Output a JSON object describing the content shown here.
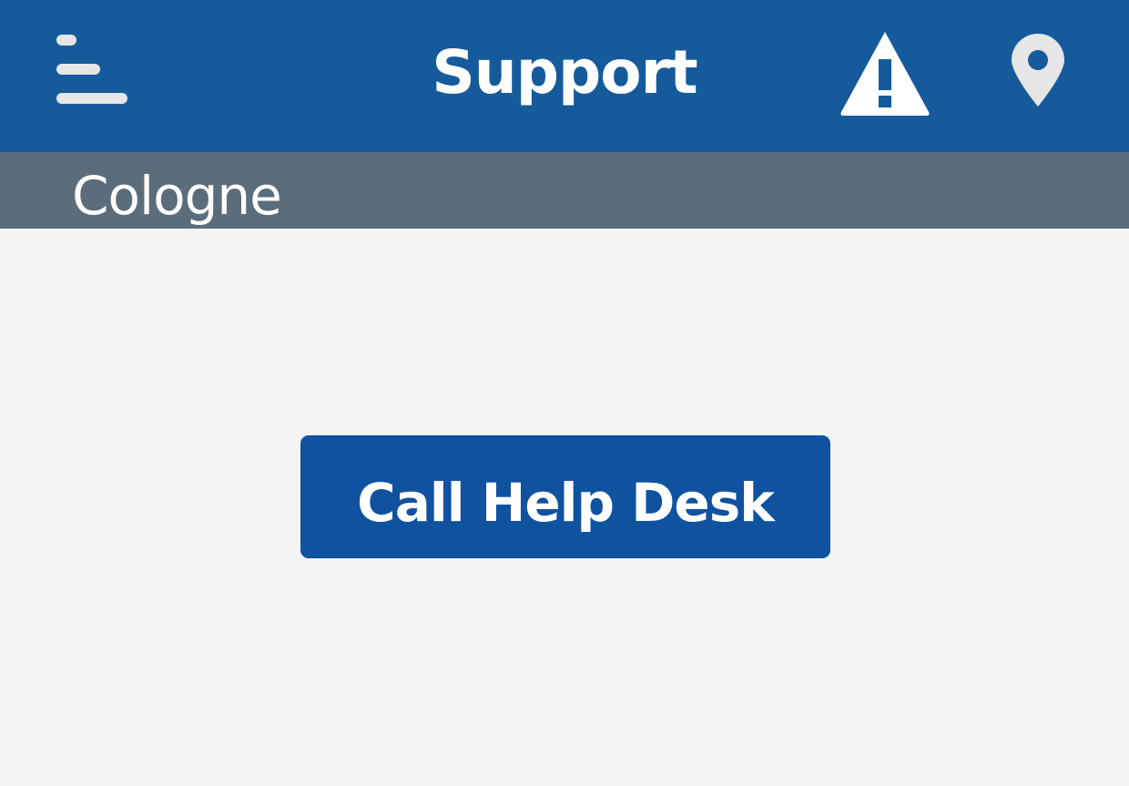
{
  "header": {
    "title": "Support",
    "menu_icon": "menu-icon",
    "alert_icon": "warning-triangle-icon",
    "location_icon": "map-pin-icon"
  },
  "location": {
    "name": "Cologne"
  },
  "main": {
    "call_button_label": "Call Help Desk"
  },
  "colors": {
    "app_bar": "#155b9b",
    "location_bar": "#5b6c7a",
    "button": "#0f52a0",
    "background": "#f4f4f4"
  }
}
